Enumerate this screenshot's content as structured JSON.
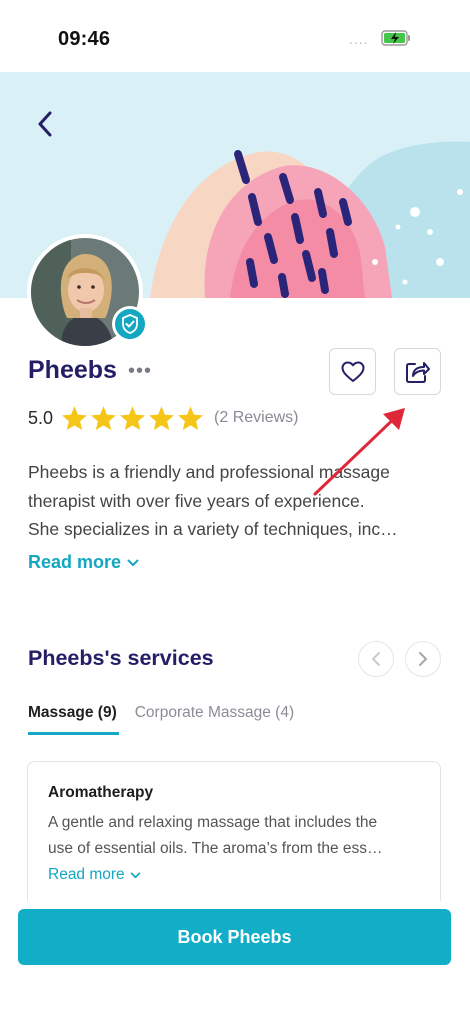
{
  "status_bar": {
    "time": "09:46",
    "signal": "....",
    "battery": "charging-battery-icon"
  },
  "profile": {
    "name": "Pheebs",
    "more": "•••",
    "rating": "5.0",
    "rating_stars": 5,
    "reviews": "(2 Reviews)",
    "description_lines": [
      "Pheebs is a friendly and professional massage",
      "therapist with over five years of experience.",
      "She specializes in a variety of techniques, inc…"
    ],
    "read_more": "Read more"
  },
  "services": {
    "title": "Pheebs's services",
    "tabs": [
      {
        "label": "Massage (9)",
        "active": true
      },
      {
        "label": "Corporate Massage (4)",
        "active": false
      }
    ],
    "card": {
      "name": "Aromatherapy",
      "description_lines": [
        "A gentle and relaxing massage that includes the",
        "use of essential oils. The aroma’s from the ess…"
      ],
      "read_more": "Read more"
    }
  },
  "book_button": "Book Pheebs",
  "colors": {
    "accent": "#13a7c2",
    "title": "#231f66",
    "star": "#f5c518",
    "annotation": "#e0273a"
  }
}
